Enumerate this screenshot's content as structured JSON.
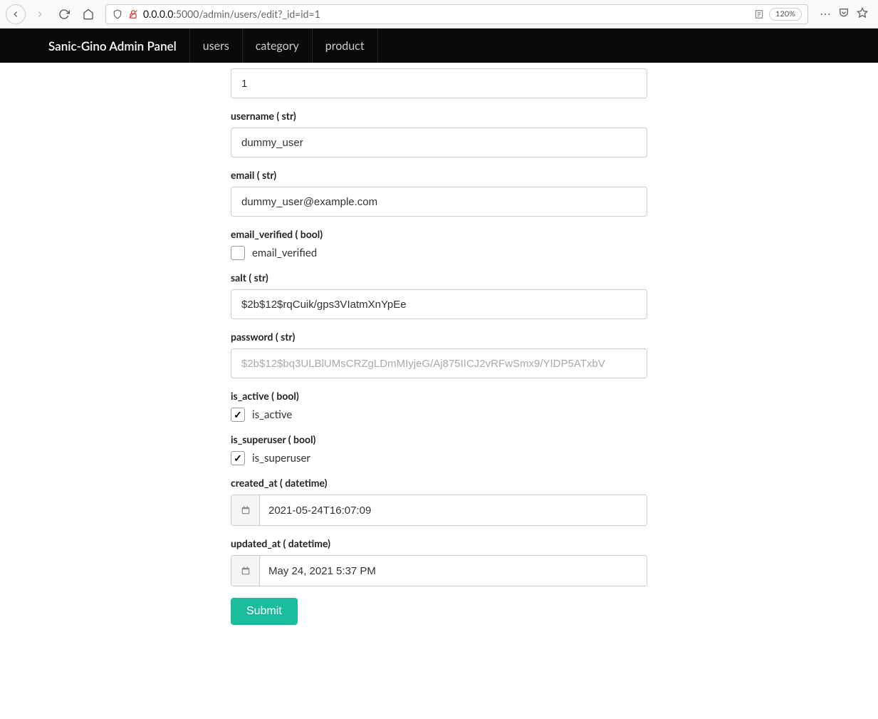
{
  "browser": {
    "url_prefix": "0.0.0.0",
    "url_rest": ":5000/admin/users/edit?_id=id=1",
    "zoom": "120%"
  },
  "navbar": {
    "brand": "Sanic-Gino Admin Panel",
    "links": [
      "users",
      "category",
      "product"
    ]
  },
  "form": {
    "id": {
      "label": "",
      "value": "1"
    },
    "username": {
      "label": "username ( str)",
      "value": "dummy_user"
    },
    "email": {
      "label": "email ( str)",
      "value": "dummy_user@example.com"
    },
    "email_verified": {
      "label": "email_verified ( bool)",
      "text": "email_verified",
      "checked": false
    },
    "salt": {
      "label": "salt ( str)",
      "value": "$2b$12$rqCuik/gps3VIatmXnYpEe"
    },
    "password": {
      "label": "password ( str)",
      "placeholder": "$2b$12$bq3ULBlUMsCRZgLDmMIyjeG/Aj875IICJ2vRFwSmx9/YIDP5ATxbV"
    },
    "is_active": {
      "label": "is_active ( bool)",
      "text": "is_active",
      "checked": true
    },
    "is_superuser": {
      "label": "is_superuser ( bool)",
      "text": "is_superuser",
      "checked": true
    },
    "created_at": {
      "label": "created_at ( datetime)",
      "value": "2021-05-24T16:07:09"
    },
    "updated_at": {
      "label": "updated_at ( datetime)",
      "value": "May 24, 2021 5:37 PM"
    },
    "submit": "Submit"
  }
}
